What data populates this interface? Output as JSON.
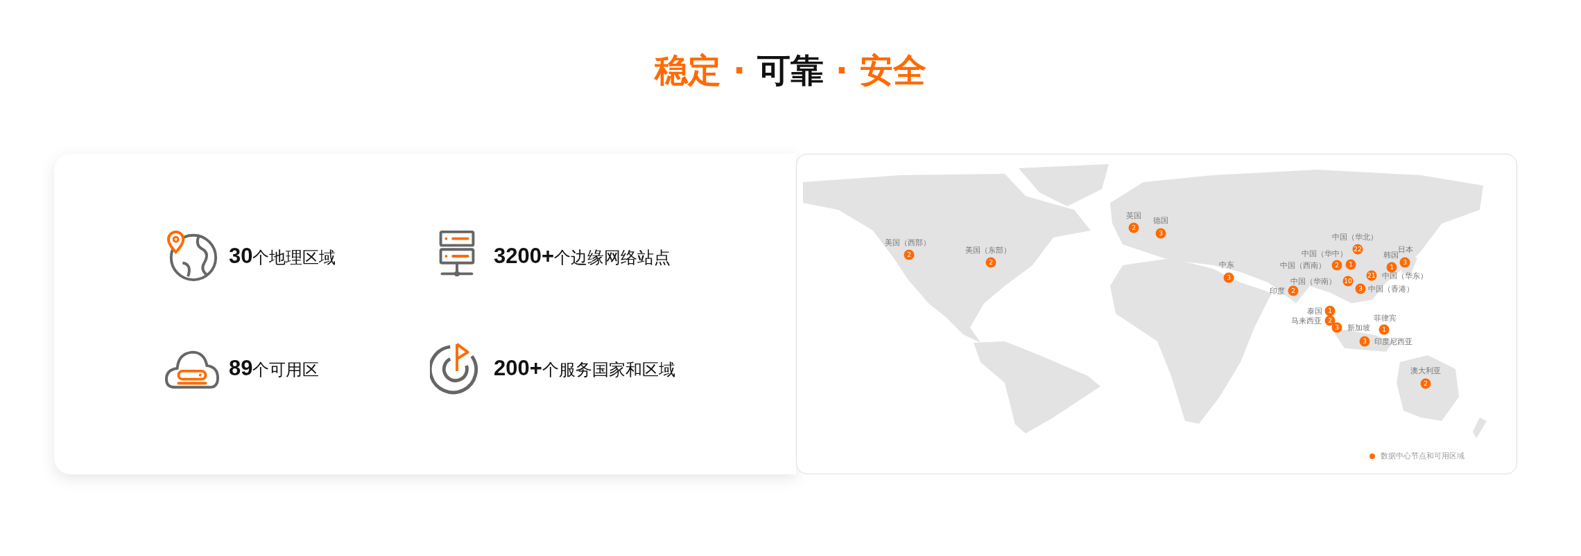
{
  "title": {
    "parts": [
      {
        "text": "稳定 · ",
        "accent": true
      },
      {
        "text": "可靠",
        "accent": false
      },
      {
        "text": " · 安全",
        "accent": true
      }
    ]
  },
  "stats": [
    {
      "kind": "globe-pin",
      "text": "**30**个地理区域"
    },
    {
      "kind": "server",
      "text": "**3200+**个边缘网络站点"
    },
    {
      "kind": "cloud",
      "text": "**89**个可用区"
    },
    {
      "kind": "target-flag",
      "text": "**200+**个服务国家和区域"
    }
  ],
  "map": {
    "markers": [
      {
        "label": "美国（西部）",
        "count": "2"
      },
      {
        "label": "美国（东部）",
        "count": "2"
      },
      {
        "label": "英国",
        "count": "2"
      },
      {
        "label": "德国",
        "count": "3"
      },
      {
        "label": "中东",
        "count": "3"
      },
      {
        "label": "中国（华北）",
        "count": "22"
      },
      {
        "label": "中国（西南）",
        "count": "2"
      },
      {
        "label": "中国（华中）",
        "count": "1"
      },
      {
        "label": "中国（华南）",
        "count": "10"
      },
      {
        "label": "印度",
        "count": "2"
      },
      {
        "label": "韩国",
        "count": "1"
      },
      {
        "label": "日本",
        "count": "3"
      },
      {
        "label": "中国（华东）",
        "count": "21"
      },
      {
        "label": "中国（香港）",
        "count": "3"
      },
      {
        "label": "泰国",
        "count": "1"
      },
      {
        "label": "马来西亚",
        "count": "2"
      },
      {
        "label": "新加坡",
        "count": "3"
      },
      {
        "label": "菲律宾",
        "count": "1"
      },
      {
        "label": "印度尼西亚",
        "count": "3"
      },
      {
        "label": "澳大利亚",
        "count": "2"
      }
    ],
    "legend": {
      "label": "数据中心节点和可用区域",
      "color": "#ff6a00"
    }
  }
}
